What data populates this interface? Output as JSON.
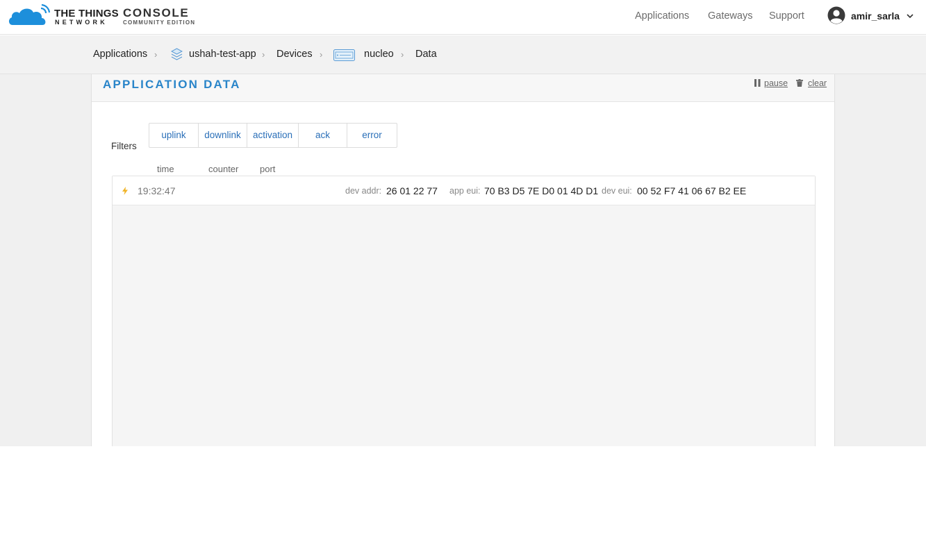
{
  "header": {
    "brand_line1": "THE THINGS",
    "brand_line2": "NETWORK",
    "brand_console": "CONSOLE",
    "brand_edition": "COMMUNITY EDITION",
    "nav": [
      "Applications",
      "Gateways",
      "Support"
    ],
    "user": "amir_sarla"
  },
  "breadcrumb": {
    "items": [
      "Applications",
      "ushah-test-app",
      "Devices",
      "nucleo",
      "Data"
    ]
  },
  "panel": {
    "title": "APPLICATION DATA",
    "pause_label": "pause",
    "clear_label": "clear"
  },
  "filters": {
    "label": "Filters",
    "buttons": [
      "uplink",
      "downlink",
      "activation",
      "ack",
      "error"
    ]
  },
  "columns": [
    "time",
    "counter",
    "port"
  ],
  "events": [
    {
      "icon": "lightning-icon",
      "time": "19:32:47",
      "dev_addr_label": "dev addr:",
      "dev_addr": "26 01 22 77",
      "app_eui_label": "app eui:",
      "app_eui": "70 B3 D5 7E D0 01 4D D1",
      "dev_eui_label": "dev eui:",
      "dev_eui": "00 52 F7 41 06 67 B2 EE"
    }
  ],
  "colors": {
    "accent": "#2a85c9",
    "link": "#2a6fb8",
    "activation_icon": "#f0b429"
  }
}
